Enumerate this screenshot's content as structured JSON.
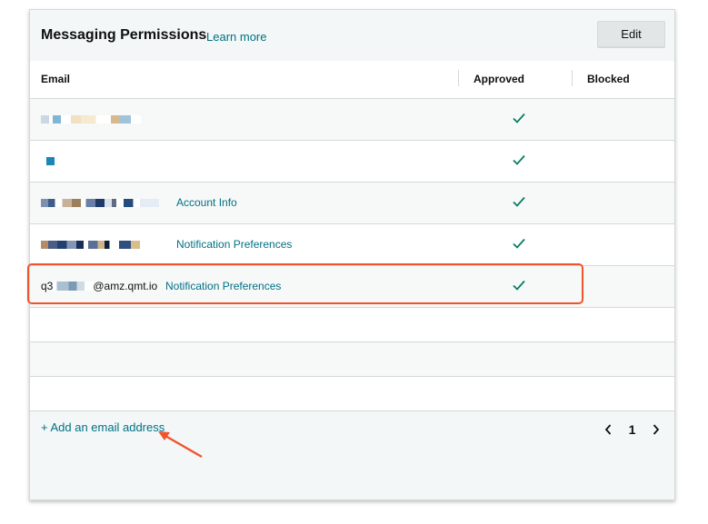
{
  "panel": {
    "title": "Messaging Permissions",
    "learn_more": "Learn more",
    "edit_label": "Edit"
  },
  "table": {
    "columns": [
      "Email",
      "Approved",
      "Blocked"
    ],
    "rows": [
      {
        "email": "",
        "link": "",
        "approved": true
      },
      {
        "email": "",
        "link": "",
        "approved": true
      },
      {
        "email": "",
        "link": "Account Info",
        "approved": true
      },
      {
        "email": "",
        "link": "Notification Preferences",
        "approved": true
      },
      {
        "email_prefix": "q3",
        "email_suffix": "@amz.qmt.io",
        "link": "Notification Preferences",
        "approved": true
      }
    ]
  },
  "footer": {
    "add_email": "+ Add an email address",
    "page": "1"
  },
  "icons": {
    "check": "checkmark-icon",
    "prev": "chevron-left-icon",
    "next": "chevron-right-icon"
  },
  "colors": {
    "link": "#007185",
    "check": "#067d62",
    "annotation": "#f0542d"
  }
}
